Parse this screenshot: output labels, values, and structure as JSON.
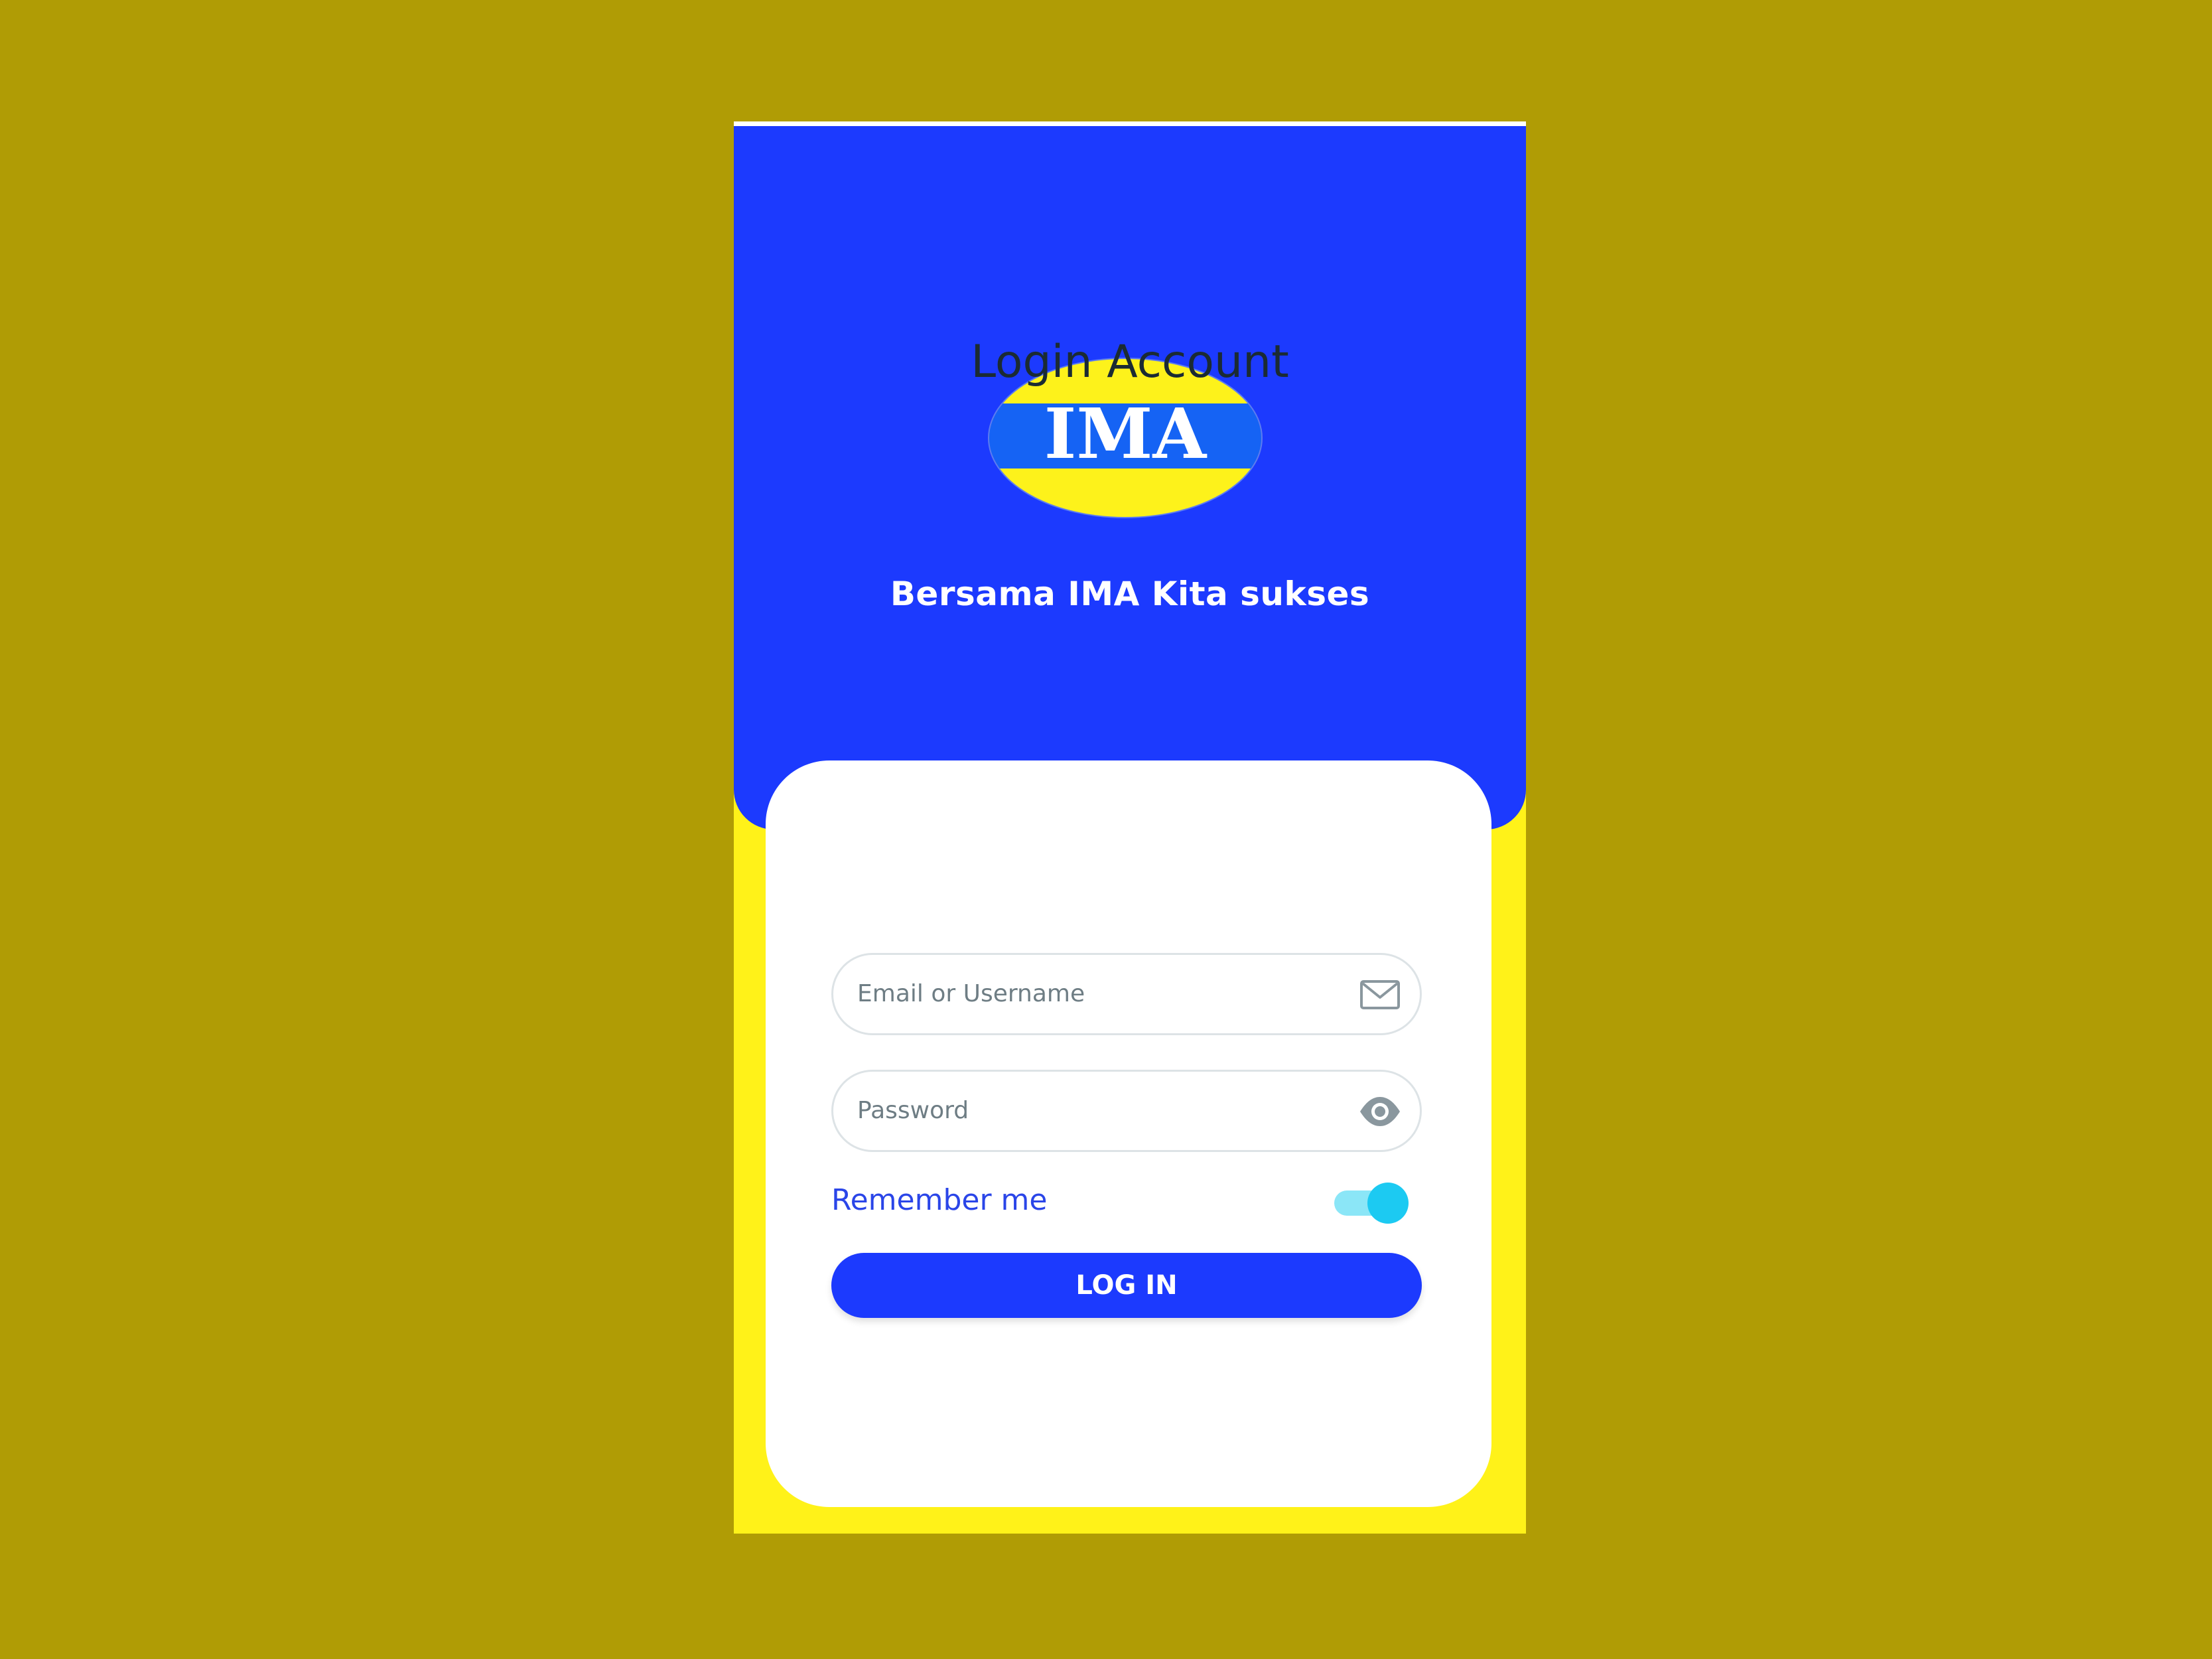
{
  "logo": {
    "text": "IMA",
    "colors": {
      "outer": "#fdf21b",
      "band": "#1563f4",
      "text": "#ffffff"
    }
  },
  "header": {
    "tagline": "Bersama IMA Kita sukses"
  },
  "form": {
    "title": "Login Account",
    "email_placeholder": "Email or Username",
    "email_icon": "mail-icon",
    "password_placeholder": "Password",
    "password_icon": "eye-icon",
    "remember_label": "Remember me",
    "remember_enabled": true,
    "login_label": "LOG IN"
  },
  "colors": {
    "background": "#b09c05",
    "primary": "#1c3afe",
    "accent_yellow": "#fff219",
    "toggle": "#1ccaf2"
  }
}
